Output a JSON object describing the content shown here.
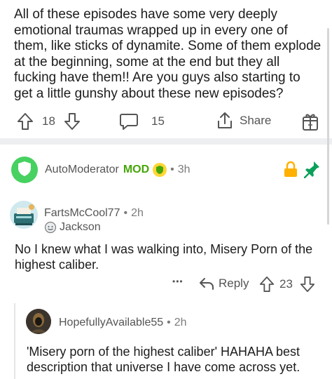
{
  "post": {
    "body": "All of these episodes have some very deeply emotional traumas wrapped up in every one of them, like sticks of dynamite.  Some of them explode at the beginning, some at the end but they all fucking have them!!  Are you guys also starting to get a little gunshy about these new episodes?",
    "vote_count": "18",
    "comment_count": "15",
    "share_label": "Share"
  },
  "automod": {
    "author": "AutoModerator",
    "mod_label": "MOD",
    "sep": "•",
    "time": "3h"
  },
  "comment1": {
    "author": "FartsMcCool77",
    "sep": "•",
    "time": "2h",
    "flair": "Jackson",
    "text": "No I knew what I was walking into, Misery Porn of the highest caliber.",
    "more": "•••",
    "reply_label": "Reply",
    "vote_count": "23"
  },
  "comment2": {
    "author": "HopefullyAvailable55",
    "sep": "•",
    "time": "2h",
    "text": "'Misery porn of the highest caliber' HAHAHA best description that universe I have come across yet."
  },
  "colors": {
    "mod_green": "#46a508",
    "lock_orange": "#ffb000",
    "pin_green": "#0aa05a"
  }
}
